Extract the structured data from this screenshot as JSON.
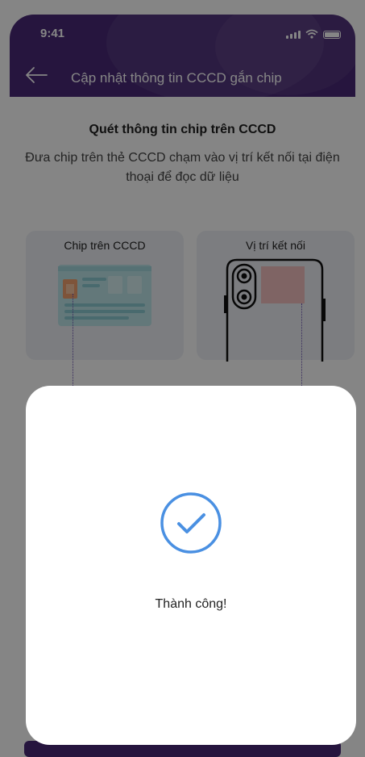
{
  "status_bar": {
    "time": "9:41"
  },
  "header": {
    "title": "Cập nhật thông tin CCCD gắn chip"
  },
  "main": {
    "heading": "Quét thông tin chip trên CCCD",
    "description": "Đưa chip trên thẻ CCCD chạm vào vị trí kết nối tại điện thoại để đọc dữ liệu",
    "cards": [
      {
        "label": "Chip trên CCCD"
      },
      {
        "label": "Vị trí kết nối"
      }
    ]
  },
  "modal": {
    "message": "Thành công!"
  },
  "colors": {
    "header": "#4a2a78",
    "success_icon": "#4a90e2",
    "overlay": "rgba(0,0,0,0.48)",
    "chip": "#f1a26f",
    "connect_area": "#f3c0c0"
  },
  "icons": [
    "back-arrow-icon",
    "signal-icon",
    "wifi-icon",
    "battery-icon",
    "id-card-illustration",
    "phone-illustration",
    "check-circle-icon"
  ]
}
